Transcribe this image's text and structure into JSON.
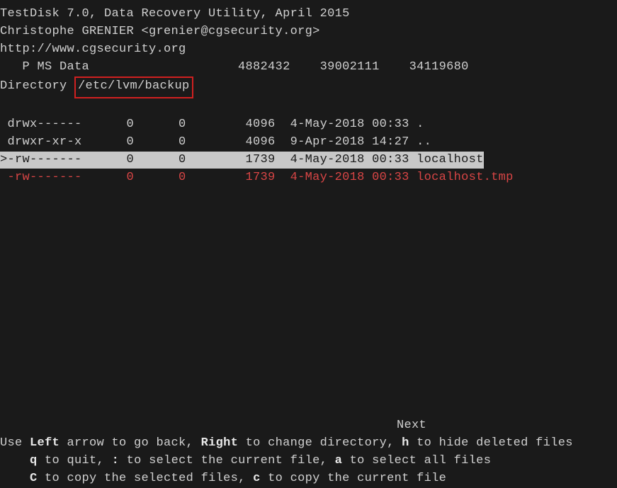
{
  "header": {
    "title": "TestDisk 7.0, Data Recovery Utility, April 2015",
    "author": "Christophe GRENIER <grenier@cgsecurity.org>",
    "url": "http://www.cgsecurity.org"
  },
  "partition": {
    "label": "   P MS Data",
    "start": "4882432",
    "end": "39002111",
    "sectors": "34119680"
  },
  "directory": {
    "label": "Directory",
    "path": "/etc/lvm/backup"
  },
  "files": [
    {
      "perms": " drwx------",
      "uid": "0",
      "gid": "0",
      "size": "4096",
      "date": "4-May-2018 00:33",
      "name": ".",
      "selected": false,
      "deleted": false
    },
    {
      "perms": " drwxr-xr-x",
      "uid": "0",
      "gid": "0",
      "size": "4096",
      "date": "9-Apr-2018 14:27",
      "name": "..",
      "selected": false,
      "deleted": false
    },
    {
      "perms": ">-rw-------",
      "uid": "0",
      "gid": "0",
      "size": "1739",
      "date": "4-May-2018 00:33",
      "name": "localhost",
      "selected": true,
      "deleted": false
    },
    {
      "perms": " -rw-------",
      "uid": "0",
      "gid": "0",
      "size": "1739",
      "date": "4-May-2018 00:33",
      "name": "localhost.tmp",
      "selected": false,
      "deleted": true
    }
  ],
  "nav": {
    "next": "Next"
  },
  "help": {
    "line1": {
      "pre": "Use ",
      "k1": "Left",
      "t1": " arrow to go back, ",
      "k2": "Right",
      "t2": " to change directory, ",
      "k3": "h",
      "t3": " to hide deleted files"
    },
    "line2": {
      "pre": "    ",
      "k1": "q",
      "t1": " to quit, ",
      "k2": ":",
      "t2": " to select the current file, ",
      "k3": "a",
      "t3": " to select all files"
    },
    "line3": {
      "pre": "    ",
      "k1": "C",
      "t1": " to copy the selected files, ",
      "k2": "c",
      "t2": " to copy the current file"
    }
  }
}
